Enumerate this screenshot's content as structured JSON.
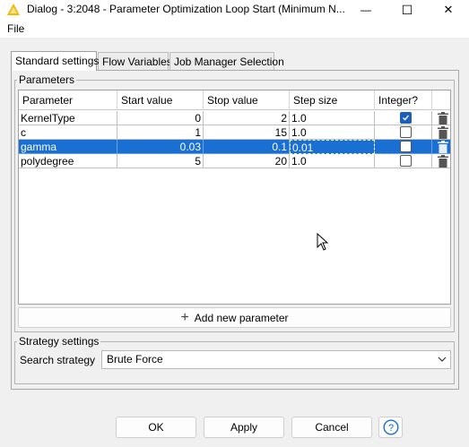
{
  "window": {
    "title": "Dialog - 3:2048 - Parameter Optimization Loop Start (Minimum N...",
    "icon": "knime-triangle-icon",
    "minimize_glyph": "—",
    "maximize_glyph": "☐",
    "close_glyph": "✕"
  },
  "menu": {
    "file": "File"
  },
  "tabs": [
    {
      "label": "Standard settings",
      "active": true
    },
    {
      "label": "Flow Variables",
      "active": false
    },
    {
      "label": "Job Manager Selection",
      "active": false
    }
  ],
  "parameters": {
    "legend": "Parameters",
    "columns": [
      "Parameter",
      "Start value",
      "Stop value",
      "Step size",
      "Integer?"
    ],
    "rows": [
      {
        "name": "KernelType",
        "start": "0",
        "stop": "2",
        "step": "1.0",
        "integer": true,
        "selected": false
      },
      {
        "name": "c",
        "start": "1",
        "stop": "15",
        "step": "1.0",
        "integer": false,
        "selected": false
      },
      {
        "name": "gamma",
        "start": "0.03",
        "stop": "0.1",
        "step": "0.01",
        "integer": false,
        "selected": true
      },
      {
        "name": "polydegree",
        "start": "5",
        "stop": "20",
        "step": "1.0",
        "integer": false,
        "selected": false
      }
    ],
    "add_button": "Add new parameter"
  },
  "strategy": {
    "legend": "Strategy settings",
    "search_label": "Search strategy",
    "search_value": "Brute Force"
  },
  "buttons": {
    "ok": "OK",
    "apply": "Apply",
    "cancel": "Cancel",
    "help": "?"
  },
  "colors": {
    "selection": "#1a6fd3",
    "checkbox_checked": "#1b5fbf",
    "accent_icon": "#f5b800"
  }
}
